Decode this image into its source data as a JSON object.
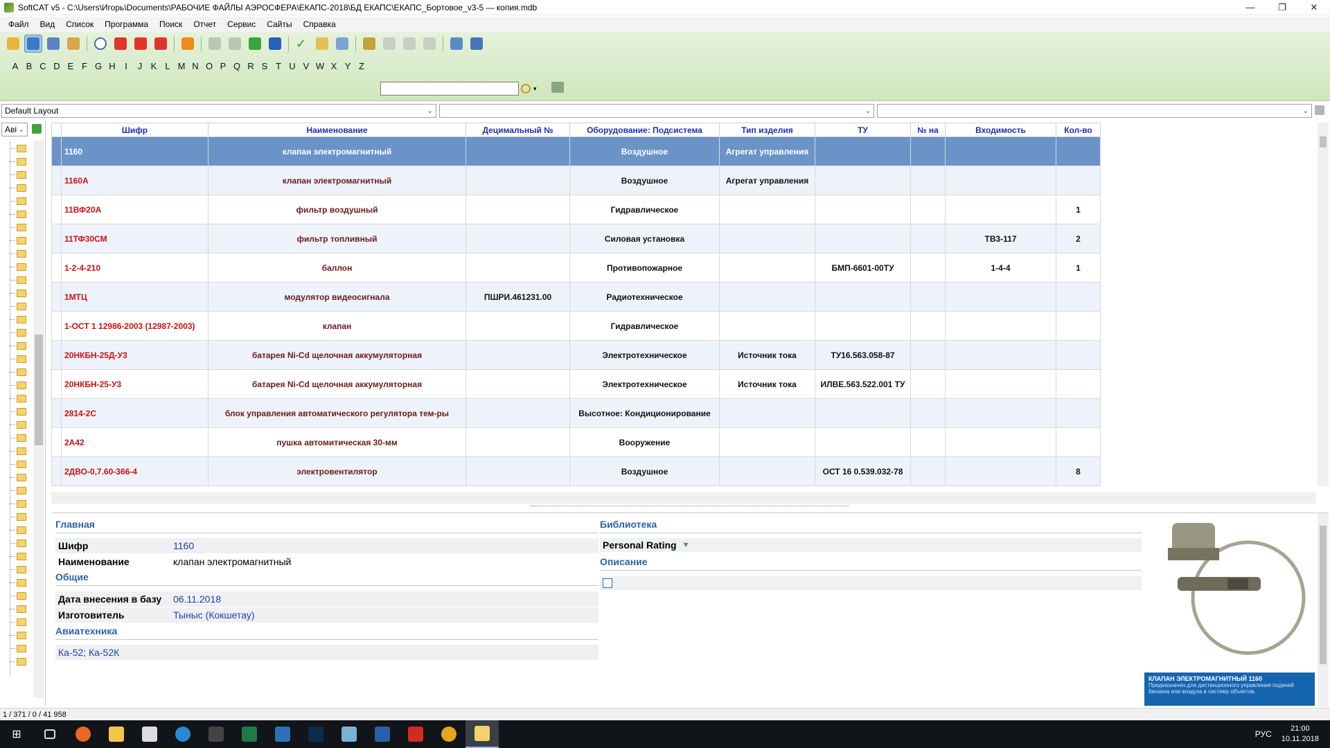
{
  "window": {
    "title": "SoftCAT v5 - C:\\Users\\Игорь\\Documents\\РАБОЧИЕ ФАЙЛЫ АЭРОСФЕРА\\ЕКАПС-2018\\БД ЕКАПС\\ЕКАПС_Бортовое_v3-5 — копия.mdb",
    "min": "—",
    "max": "❐",
    "close": "✕"
  },
  "menu": [
    "Файл",
    "Вид",
    "Список",
    "Программа",
    "Поиск",
    "Отчет",
    "Сервис",
    "Сайты",
    "Справка"
  ],
  "alphabet": [
    "A",
    "B",
    "C",
    "D",
    "E",
    "F",
    "G",
    "H",
    "I",
    "J",
    "K",
    "L",
    "M",
    "N",
    "O",
    "P",
    "Q",
    "R",
    "S",
    "T",
    "U",
    "V",
    "W",
    "X",
    "Y",
    "Z"
  ],
  "search": {
    "value": ""
  },
  "layouts": {
    "layout1": "Default Layout",
    "layout2": "",
    "layout3": ""
  },
  "left": {
    "combo": "Авi"
  },
  "grid": {
    "columns": [
      "Шифр",
      "Наименование",
      "Децимальный №",
      "Оборудование: Подсистема",
      "Тип изделия",
      "ТУ",
      "№ на",
      "Входимость",
      "Кол-во"
    ],
    "rows": [
      [
        "1160",
        "клапан электромагнитный",
        "",
        "Воздушное",
        "Агрегат управления",
        "",
        "",
        "",
        ""
      ],
      [
        "1160А",
        "клапан электромагнитный",
        "",
        "Воздушное",
        "Агрегат управления",
        "",
        "",
        "",
        ""
      ],
      [
        "11ВФ20А",
        "фильтр воздушный",
        "",
        "Гидравлическое",
        "",
        "",
        "",
        "",
        "1"
      ],
      [
        "11ТФ30СМ",
        "фильтр топливный",
        "",
        "Силовая установка",
        "",
        "",
        "",
        "ТВ3-117",
        "2"
      ],
      [
        "1-2-4-210",
        "баллон",
        "",
        "Противопожарное",
        "",
        "БМП-6601-00ТУ",
        "",
        "1-4-4",
        "1"
      ],
      [
        "1МТЦ",
        "модулятор видеосигнала",
        "ПШРИ.461231.00",
        "Радиотехническое",
        "",
        "",
        "",
        "",
        ""
      ],
      [
        "1-ОСТ 1 12986-2003 (12987-2003)",
        "клапан",
        "",
        "Гидравлическое",
        "",
        "",
        "",
        "",
        ""
      ],
      [
        "20НКБН-25Д-У3",
        "батарея Ni-Cd щелочная аккумуляторная",
        "",
        "Электротехническое",
        "Источник тока",
        "ТУ16.563.058-87",
        "",
        "",
        ""
      ],
      [
        "20НКБН-25-У3",
        "батарея Ni-Cd щелочная аккумуляторная",
        "",
        "Электротехническое",
        "Источник тока",
        "ИЛВЕ.563.522.001 ТУ",
        "",
        "",
        ""
      ],
      [
        "2814-2С",
        "блок управления автоматического регулятора тем-ры",
        "",
        "Высотное: Кондиционирование",
        "",
        "",
        "",
        "",
        ""
      ],
      [
        "2А42",
        "пушка автомитическая 30-мм",
        "",
        "Вооружение",
        "",
        "",
        "",
        "",
        ""
      ],
      [
        "2ДВО-0,7.60-366-4",
        "электровентилятор",
        "",
        "Воздушное",
        "",
        "ОСТ 16 0.539.032-78",
        "",
        "",
        "8"
      ]
    ]
  },
  "detail": {
    "main_title": "Главная",
    "code_label": "Шифр",
    "code_value": "1160",
    "name_label": "Наименование",
    "name_value": "клапан электромагнитный",
    "general_title": "Общие",
    "date_label": "Дата внесения в базу",
    "date_value": "06.11.2018",
    "maker_label": "Изготовитель",
    "maker_value": "Тыныс (Кокшетау)",
    "avia_title": "Авиатехника",
    "avia_value": "Ка-52; Ка-52К",
    "library_title": "Библиотека",
    "rating_label": "Personal Rating",
    "description_title": "Описание",
    "picture_caption_title": "КЛАПАН ЭЛЕКТРОМАГНИТНЫЙ 1160",
    "picture_caption_text": "Предназначен для дистанционного управления подачей бензина или воздуха в систему объектов."
  },
  "status": "1 / 371 / 0 / 41 958",
  "tray": {
    "lang": "РУС",
    "time": "21:00",
    "date": "10.11.2018"
  },
  "colors": {
    "toolbar_green": "#d8ecc8",
    "selected_row": "#6b93c8",
    "header_text": "#1b2fb3",
    "code_red": "#cc1111"
  }
}
